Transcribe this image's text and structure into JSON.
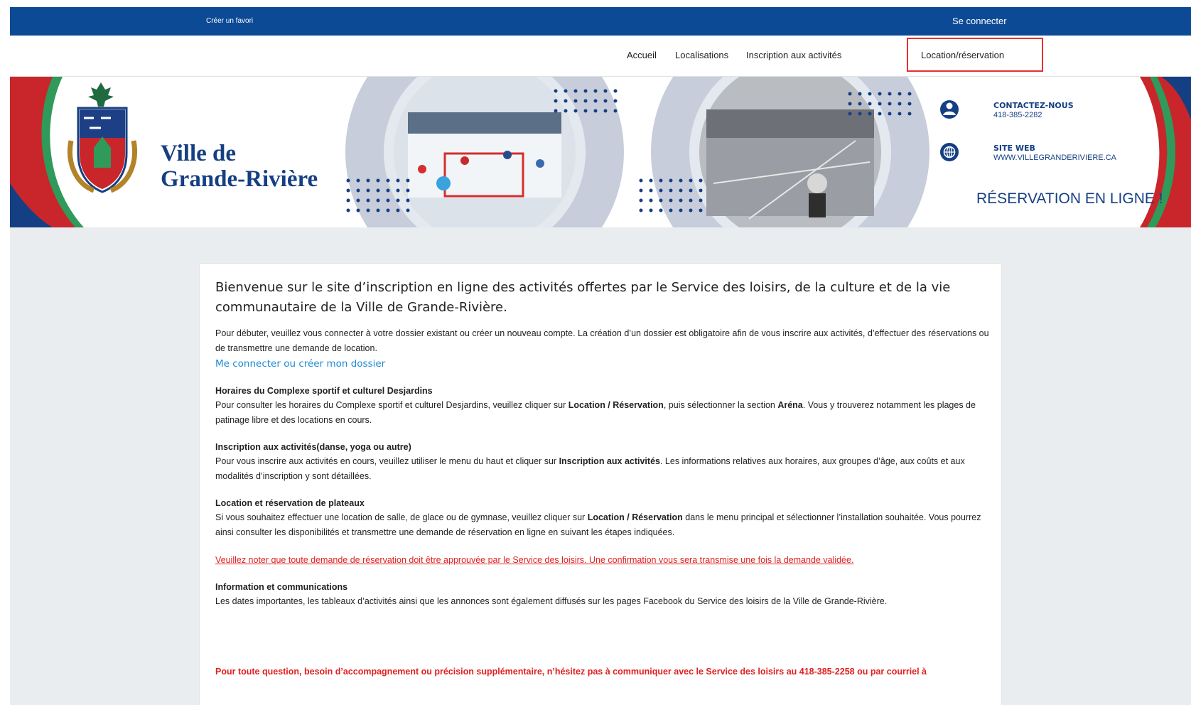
{
  "topbar": {
    "favorite_label": "Créer un favori",
    "login_label": "Se connecter",
    "bg_color": "#0c4a96"
  },
  "nav": {
    "items": [
      {
        "label": "Accueil"
      },
      {
        "label": "Localisations"
      },
      {
        "label": "Inscription aux activités"
      },
      {
        "label": "Location/réservation"
      }
    ],
    "highlight_color": "#e3322f"
  },
  "banner": {
    "title_line1": "Ville de",
    "title_line2": "Grande-Rivière",
    "contact_title": "CONTACTEZ-NOUS",
    "contact_phone": "418-385-2282",
    "web_title": "SITE WEB",
    "web_url": "WWW.VILLEGRANDERIVIERE.CA",
    "tagline": "RÉSERVATION EN LIGNE !",
    "colors": {
      "blue": "#153f83",
      "red": "#c8262a",
      "green": "#2f9a5a"
    }
  },
  "content": {
    "welcome": "Bienvenue sur le site d’inscription en ligne des activités offertes par le Service des loisirs, de la culture et de la vie communautaire de la Ville de Grande-Rivière.",
    "intro": "Pour débuter, veuillez vous connecter à votre dossier existant ou créer un nouveau compte. La création d’un dossier est obligatoire afin de vous inscrire aux activités, d’effectuer des réservations ou de transmettre une demande de location.",
    "login_link": "Me connecter ou créer mon dossier",
    "s1_title": "Horaires du Complexe sportif et culturel Desjardins",
    "s1_a": "Pour consulter les horaires du Complexe sportif et culturel Desjardins, veuillez cliquer sur ",
    "s1_b": "Location / Réservation",
    "s1_c": ", puis sélectionner la section ",
    "s1_d": "Aréna",
    "s1_e": ". Vous y trouverez notamment les plages de patinage libre et des locations en cours.",
    "s2_title": "Inscription aux activités(danse, yoga ou autre)",
    "s2_a": "Pour vous inscrire aux activités en cours, veuillez utiliser le menu du haut et cliquer sur ",
    "s2_b": "Inscription aux activités",
    "s2_c": ". Les informations relatives aux horaires, aux groupes d’âge, aux coûts et aux modalités d’inscription y sont détaillées.",
    "s3_title": "Location et réservation de plateaux",
    "s3_a": "Si vous souhaitez effectuer une location de salle, de glace ou de gymnase, veuillez cliquer sur ",
    "s3_b": "Location / Réservation",
    "s3_c": " dans le menu principal et sélectionner l’installation souhaitée. Vous pourrez ainsi consulter les disponibilités et transmettre une demande de réservation en ligne en suivant les étapes indiquées.",
    "warning": "Veuillez noter que toute demande de réservation doit être approuvée par le Service des loisirs. Une confirmation vous sera transmise une fois la demande validée.",
    "s4_title": "Information et communications",
    "s4_text": "Les dates importantes, les tableaux d’activités ainsi que les annonces sont également diffusés sur les pages Facebook du Service des loisirs de la Ville de Grande-Rivière.",
    "contact_note": "Pour toute question, besoin d’accompagnement ou précision supplémentaire, n’hésitez pas à communiquer avec le Service des loisirs au 418-385-2258 ou par courriel à"
  }
}
